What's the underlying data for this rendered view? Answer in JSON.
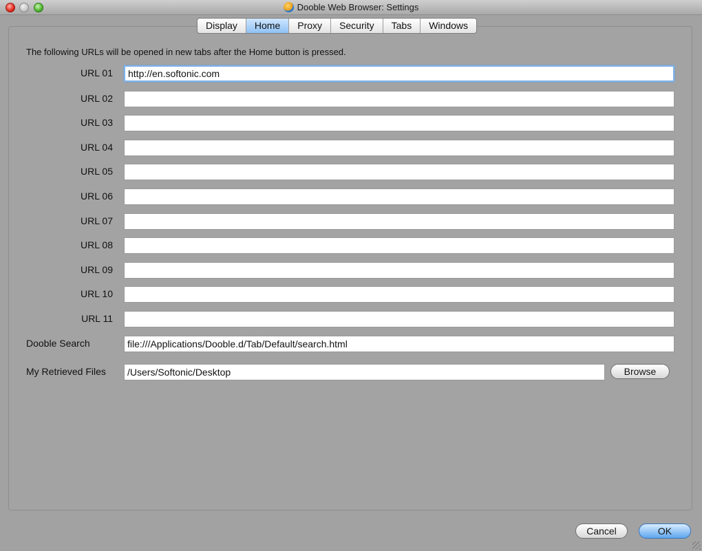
{
  "window": {
    "title": "Dooble Web Browser: Settings",
    "tabs": [
      "Display",
      "Home",
      "Proxy",
      "Security",
      "Tabs",
      "Windows"
    ],
    "active_tab": "Home"
  },
  "home": {
    "intro": "The following URLs will be opened in new tabs after the Home button is pressed.",
    "urls": [
      {
        "label": "URL 01",
        "value": "http://en.softonic.com"
      },
      {
        "label": "URL 02",
        "value": ""
      },
      {
        "label": "URL 03",
        "value": ""
      },
      {
        "label": "URL 04",
        "value": ""
      },
      {
        "label": "URL 05",
        "value": ""
      },
      {
        "label": "URL 06",
        "value": ""
      },
      {
        "label": "URL 07",
        "value": ""
      },
      {
        "label": "URL 08",
        "value": ""
      },
      {
        "label": "URL 09",
        "value": ""
      },
      {
        "label": "URL 10",
        "value": ""
      },
      {
        "label": "URL 11",
        "value": ""
      }
    ],
    "dooble_search": {
      "label": "Dooble Search",
      "value": "file:///Applications/Dooble.d/Tab/Default/search.html"
    },
    "retrieved_files": {
      "label": "My Retrieved Files",
      "value": "/Users/Softonic/Desktop"
    },
    "browse_label": "Browse"
  },
  "footer": {
    "cancel_label": "Cancel",
    "ok_label": "OK"
  }
}
